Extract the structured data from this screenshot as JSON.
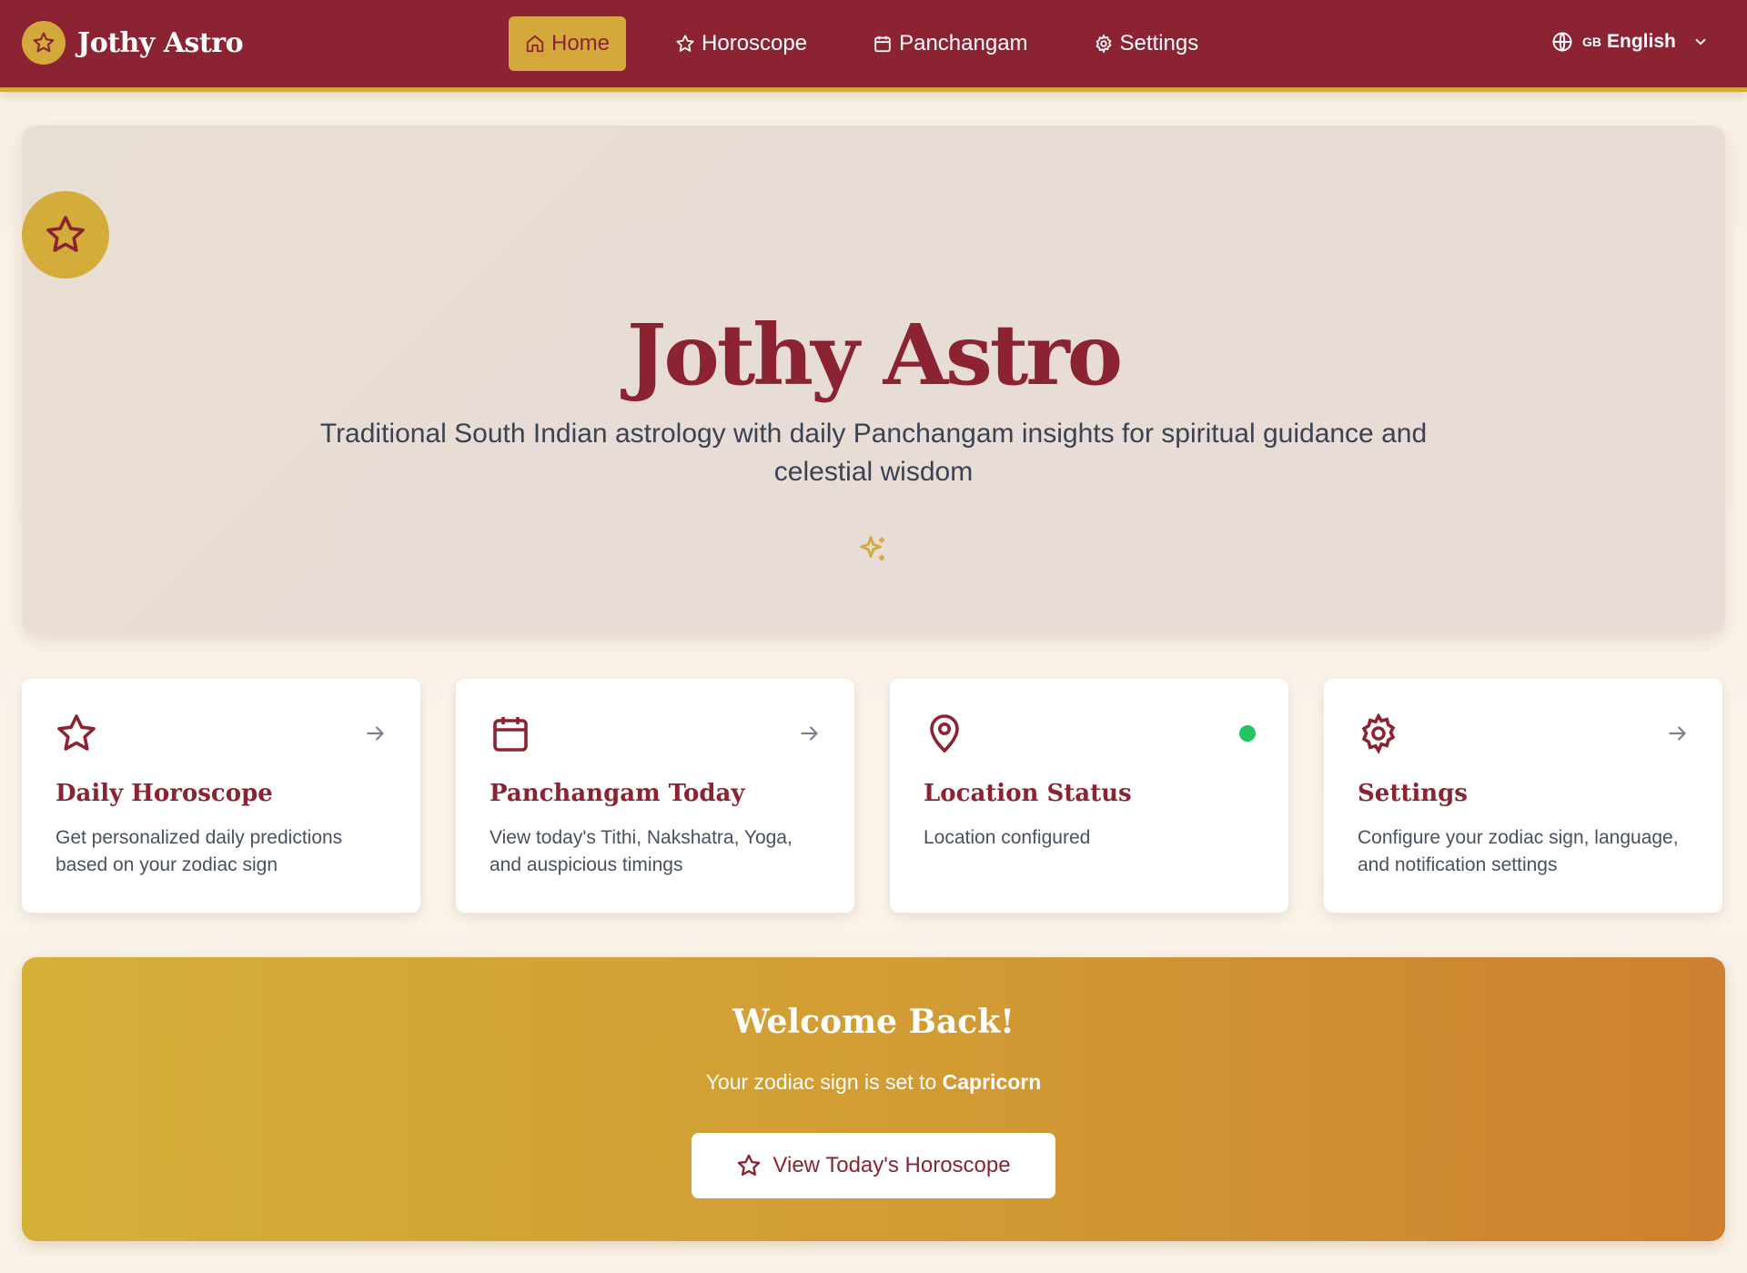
{
  "header": {
    "brand_name": "Jothy Astro",
    "nav": [
      {
        "label": "Home",
        "icon": "home-icon",
        "active": true
      },
      {
        "label": "Horoscope",
        "icon": "star-icon",
        "active": false
      },
      {
        "label": "Panchangam",
        "icon": "calendar-icon",
        "active": false
      },
      {
        "label": "Settings",
        "icon": "gear-icon",
        "active": false
      }
    ],
    "language": {
      "flag": "GB",
      "label": "English"
    }
  },
  "hero": {
    "title": "Jothy Astro",
    "subtitle": "Traditional South Indian astrology with daily Panchangam insights for spiritual guidance and celestial wisdom"
  },
  "cards": [
    {
      "title": "Daily Horoscope",
      "description": "Get personalized daily predictions based on your zodiac sign",
      "icon": "star-icon",
      "indicator": "arrow"
    },
    {
      "title": "Panchangam Today",
      "description": "View today's Tithi, Nakshatra, Yoga, and auspicious timings",
      "icon": "calendar-icon",
      "indicator": "arrow"
    },
    {
      "title": "Location Status",
      "description": "Location configured",
      "icon": "map-pin-icon",
      "indicator": "status-dot"
    },
    {
      "title": "Settings",
      "description": "Configure your zodiac sign, language, and notification settings",
      "icon": "gear-icon",
      "indicator": "arrow"
    }
  ],
  "welcome": {
    "title": "Welcome Back!",
    "text_prefix": "Your zodiac sign is set to ",
    "zodiac_sign": "Capricorn",
    "button_label": "View Today's Horoscope"
  },
  "colors": {
    "primary": "#8b2332",
    "accent": "#d4a93c",
    "status_ok": "#22c55e"
  }
}
